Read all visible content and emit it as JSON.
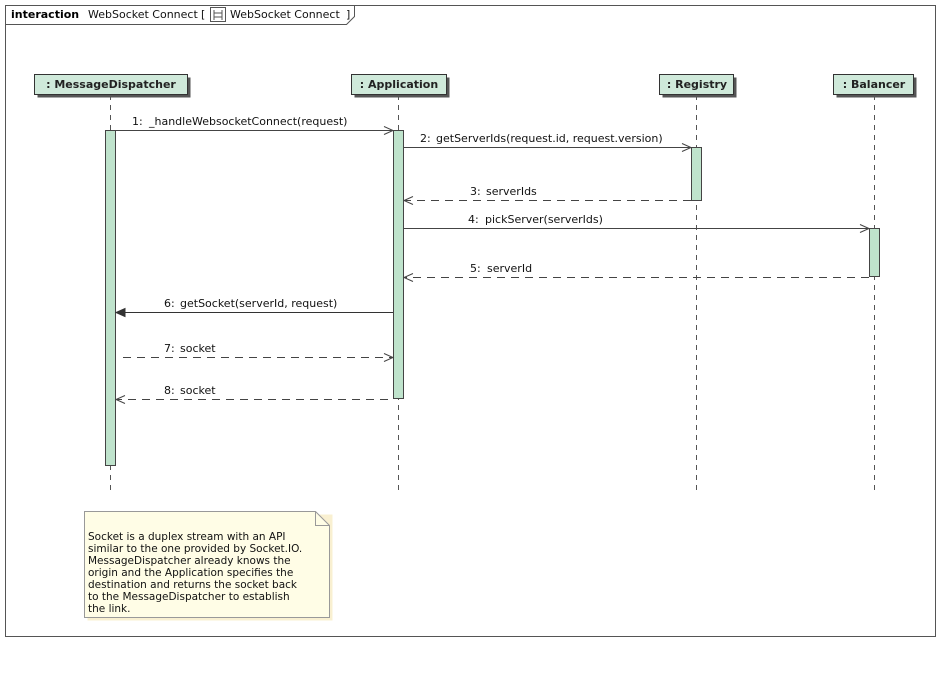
{
  "frame": {
    "keyword": "interaction",
    "name": "WebSocket Connect",
    "bracket_open": "[",
    "ref_label": "WebSocket Connect",
    "bracket_close": "]"
  },
  "lifelines": [
    {
      "id": "dispatcher",
      "label": ": MessageDispatcher"
    },
    {
      "id": "application",
      "label": ": Application"
    },
    {
      "id": "registry",
      "label": ": Registry"
    },
    {
      "id": "balancer",
      "label": ": Balancer"
    }
  ],
  "messages": [
    {
      "num": "1:",
      "text": "_handleWebsocketConnect(request)",
      "from": "dispatcher",
      "to": "application",
      "kind": "call"
    },
    {
      "num": "2:",
      "text": "getServerIds(request.id, request.version)",
      "from": "application",
      "to": "registry",
      "kind": "call"
    },
    {
      "num": "3:",
      "text": "serverIds",
      "from": "registry",
      "to": "application",
      "kind": "return"
    },
    {
      "num": "4:",
      "text": "pickServer(serverIds)",
      "from": "application",
      "to": "balancer",
      "kind": "call"
    },
    {
      "num": "5:",
      "text": "serverId",
      "from": "balancer",
      "to": "application",
      "kind": "return"
    },
    {
      "num": "6:",
      "text": "getSocket(serverId, request)",
      "from": "application",
      "to": "dispatcher",
      "kind": "sync"
    },
    {
      "num": "7:",
      "text": "socket",
      "from": "dispatcher",
      "to": "application",
      "kind": "return"
    },
    {
      "num": "8:",
      "text": "socket",
      "from": "application",
      "to": "dispatcher",
      "kind": "return"
    }
  ],
  "note": {
    "lines": [
      "Socket is a duplex stream with an API",
      "similar to the one provided by Socket.IO.",
      "MessageDispatcher already knows the",
      "origin and the Application specifies the",
      "destination and returns the socket back",
      "to the MessageDispatcher to establish",
      "the link."
    ]
  },
  "colors": {
    "lifeline_head_fill": "#cfe9da",
    "activation_fill": "#bfe3cc",
    "note_fill": "#fffde6",
    "line": "#333333"
  },
  "icons": {
    "frame_ref": "interaction-ref-icon"
  }
}
